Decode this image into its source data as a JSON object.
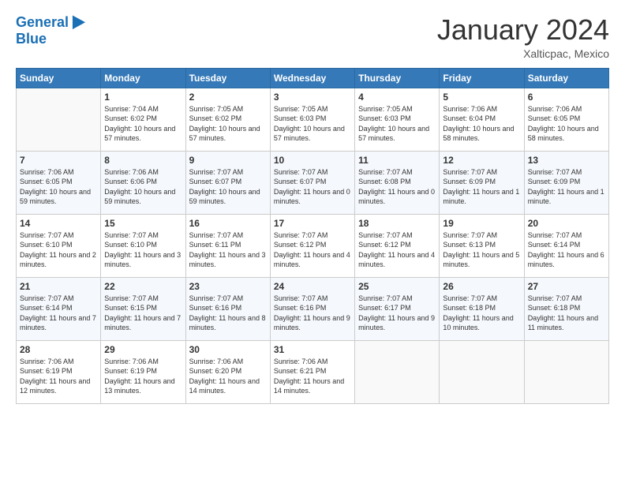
{
  "header": {
    "logo_line1": "General",
    "logo_line2": "Blue",
    "month": "January 2024",
    "location": "Xalticpac, Mexico"
  },
  "weekdays": [
    "Sunday",
    "Monday",
    "Tuesday",
    "Wednesday",
    "Thursday",
    "Friday",
    "Saturday"
  ],
  "weeks": [
    [
      {
        "day": "",
        "sunrise": "",
        "sunset": "",
        "daylight": ""
      },
      {
        "day": "1",
        "sunrise": "Sunrise: 7:04 AM",
        "sunset": "Sunset: 6:02 PM",
        "daylight": "Daylight: 10 hours and 57 minutes."
      },
      {
        "day": "2",
        "sunrise": "Sunrise: 7:05 AM",
        "sunset": "Sunset: 6:02 PM",
        "daylight": "Daylight: 10 hours and 57 minutes."
      },
      {
        "day": "3",
        "sunrise": "Sunrise: 7:05 AM",
        "sunset": "Sunset: 6:03 PM",
        "daylight": "Daylight: 10 hours and 57 minutes."
      },
      {
        "day": "4",
        "sunrise": "Sunrise: 7:05 AM",
        "sunset": "Sunset: 6:03 PM",
        "daylight": "Daylight: 10 hours and 57 minutes."
      },
      {
        "day": "5",
        "sunrise": "Sunrise: 7:06 AM",
        "sunset": "Sunset: 6:04 PM",
        "daylight": "Daylight: 10 hours and 58 minutes."
      },
      {
        "day": "6",
        "sunrise": "Sunrise: 7:06 AM",
        "sunset": "Sunset: 6:05 PM",
        "daylight": "Daylight: 10 hours and 58 minutes."
      }
    ],
    [
      {
        "day": "7",
        "sunrise": "Sunrise: 7:06 AM",
        "sunset": "Sunset: 6:05 PM",
        "daylight": "Daylight: 10 hours and 59 minutes."
      },
      {
        "day": "8",
        "sunrise": "Sunrise: 7:06 AM",
        "sunset": "Sunset: 6:06 PM",
        "daylight": "Daylight: 10 hours and 59 minutes."
      },
      {
        "day": "9",
        "sunrise": "Sunrise: 7:07 AM",
        "sunset": "Sunset: 6:07 PM",
        "daylight": "Daylight: 10 hours and 59 minutes."
      },
      {
        "day": "10",
        "sunrise": "Sunrise: 7:07 AM",
        "sunset": "Sunset: 6:07 PM",
        "daylight": "Daylight: 11 hours and 0 minutes."
      },
      {
        "day": "11",
        "sunrise": "Sunrise: 7:07 AM",
        "sunset": "Sunset: 6:08 PM",
        "daylight": "Daylight: 11 hours and 0 minutes."
      },
      {
        "day": "12",
        "sunrise": "Sunrise: 7:07 AM",
        "sunset": "Sunset: 6:09 PM",
        "daylight": "Daylight: 11 hours and 1 minute."
      },
      {
        "day": "13",
        "sunrise": "Sunrise: 7:07 AM",
        "sunset": "Sunset: 6:09 PM",
        "daylight": "Daylight: 11 hours and 1 minute."
      }
    ],
    [
      {
        "day": "14",
        "sunrise": "Sunrise: 7:07 AM",
        "sunset": "Sunset: 6:10 PM",
        "daylight": "Daylight: 11 hours and 2 minutes."
      },
      {
        "day": "15",
        "sunrise": "Sunrise: 7:07 AM",
        "sunset": "Sunset: 6:10 PM",
        "daylight": "Daylight: 11 hours and 3 minutes."
      },
      {
        "day": "16",
        "sunrise": "Sunrise: 7:07 AM",
        "sunset": "Sunset: 6:11 PM",
        "daylight": "Daylight: 11 hours and 3 minutes."
      },
      {
        "day": "17",
        "sunrise": "Sunrise: 7:07 AM",
        "sunset": "Sunset: 6:12 PM",
        "daylight": "Daylight: 11 hours and 4 minutes."
      },
      {
        "day": "18",
        "sunrise": "Sunrise: 7:07 AM",
        "sunset": "Sunset: 6:12 PM",
        "daylight": "Daylight: 11 hours and 4 minutes."
      },
      {
        "day": "19",
        "sunrise": "Sunrise: 7:07 AM",
        "sunset": "Sunset: 6:13 PM",
        "daylight": "Daylight: 11 hours and 5 minutes."
      },
      {
        "day": "20",
        "sunrise": "Sunrise: 7:07 AM",
        "sunset": "Sunset: 6:14 PM",
        "daylight": "Daylight: 11 hours and 6 minutes."
      }
    ],
    [
      {
        "day": "21",
        "sunrise": "Sunrise: 7:07 AM",
        "sunset": "Sunset: 6:14 PM",
        "daylight": "Daylight: 11 hours and 7 minutes."
      },
      {
        "day": "22",
        "sunrise": "Sunrise: 7:07 AM",
        "sunset": "Sunset: 6:15 PM",
        "daylight": "Daylight: 11 hours and 7 minutes."
      },
      {
        "day": "23",
        "sunrise": "Sunrise: 7:07 AM",
        "sunset": "Sunset: 6:16 PM",
        "daylight": "Daylight: 11 hours and 8 minutes."
      },
      {
        "day": "24",
        "sunrise": "Sunrise: 7:07 AM",
        "sunset": "Sunset: 6:16 PM",
        "daylight": "Daylight: 11 hours and 9 minutes."
      },
      {
        "day": "25",
        "sunrise": "Sunrise: 7:07 AM",
        "sunset": "Sunset: 6:17 PM",
        "daylight": "Daylight: 11 hours and 9 minutes."
      },
      {
        "day": "26",
        "sunrise": "Sunrise: 7:07 AM",
        "sunset": "Sunset: 6:18 PM",
        "daylight": "Daylight: 11 hours and 10 minutes."
      },
      {
        "day": "27",
        "sunrise": "Sunrise: 7:07 AM",
        "sunset": "Sunset: 6:18 PM",
        "daylight": "Daylight: 11 hours and 11 minutes."
      }
    ],
    [
      {
        "day": "28",
        "sunrise": "Sunrise: 7:06 AM",
        "sunset": "Sunset: 6:19 PM",
        "daylight": "Daylight: 11 hours and 12 minutes."
      },
      {
        "day": "29",
        "sunrise": "Sunrise: 7:06 AM",
        "sunset": "Sunset: 6:19 PM",
        "daylight": "Daylight: 11 hours and 13 minutes."
      },
      {
        "day": "30",
        "sunrise": "Sunrise: 7:06 AM",
        "sunset": "Sunset: 6:20 PM",
        "daylight": "Daylight: 11 hours and 14 minutes."
      },
      {
        "day": "31",
        "sunrise": "Sunrise: 7:06 AM",
        "sunset": "Sunset: 6:21 PM",
        "daylight": "Daylight: 11 hours and 14 minutes."
      },
      {
        "day": "",
        "sunrise": "",
        "sunset": "",
        "daylight": ""
      },
      {
        "day": "",
        "sunrise": "",
        "sunset": "",
        "daylight": ""
      },
      {
        "day": "",
        "sunrise": "",
        "sunset": "",
        "daylight": ""
      }
    ]
  ]
}
